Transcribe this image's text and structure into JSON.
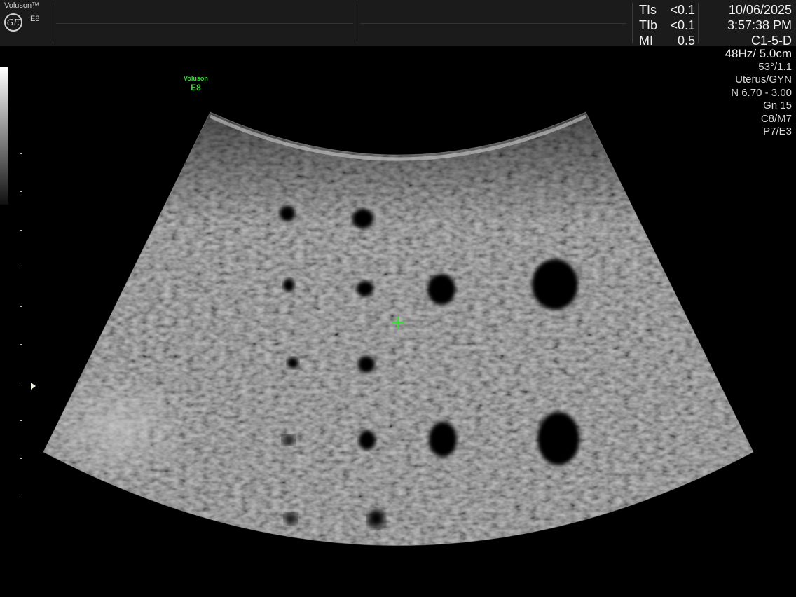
{
  "header": {
    "brand": "Voluson™",
    "model": "E8",
    "logo_text": "GE",
    "indices": [
      {
        "label": "TIs",
        "value": "<0.1"
      },
      {
        "label": "TIb",
        "value": "<0.1"
      },
      {
        "label": "MI",
        "value": "0.5"
      }
    ],
    "date": "10/06/2025",
    "time": "3:57:38 PM",
    "probe": "C1-5-D"
  },
  "parameters": {
    "frame_depth": "48Hz/ 5.0cm",
    "angle": "53°/1.1",
    "preset": "Uterus/GYN",
    "frequency": "N 6.70 - 3.00",
    "gain": "Gn  15",
    "map": "C8/M7",
    "power": "P7/E3"
  },
  "watermark": {
    "line1": "Voluson",
    "line2": "E8"
  },
  "icons": {
    "logo": "ge-logo-icon",
    "focus": "focus-marker-icon",
    "cursor": "crosshair-cursor-icon"
  },
  "colors": {
    "cursor": "#3dd63d",
    "watermark": "#3dd63d",
    "topbar": "#1b1b1b"
  }
}
